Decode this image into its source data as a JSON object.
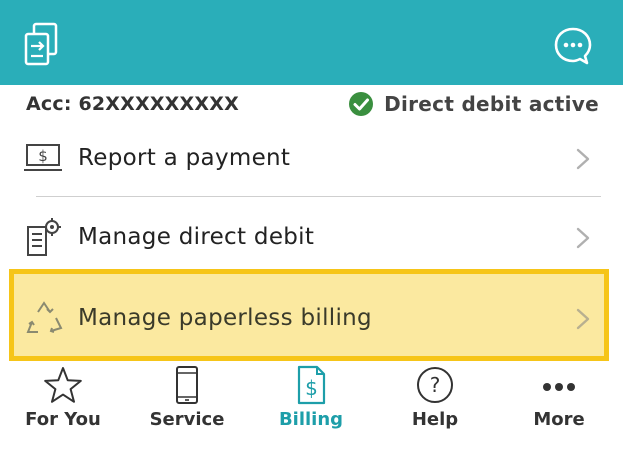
{
  "account": {
    "label": "Acc: 62XXXXXXXXX",
    "status": "Direct debit active",
    "status_color": "#3a8f3f"
  },
  "menu": {
    "items": [
      {
        "label": "Report a payment",
        "icon": "cash-screen-icon"
      },
      {
        "label": "Manage direct debit",
        "icon": "document-gear-icon"
      },
      {
        "label": "Manage paperless billing",
        "icon": "recycle-icon",
        "highlighted": true
      }
    ]
  },
  "tabs": [
    {
      "label": "For You",
      "icon": "star-icon"
    },
    {
      "label": "Service",
      "icon": "phone-icon"
    },
    {
      "label": "Billing",
      "icon": "bill-dollar-icon",
      "active": true
    },
    {
      "label": "Help",
      "icon": "question-icon"
    },
    {
      "label": "More",
      "icon": "more-dots-icon"
    }
  ],
  "colors": {
    "header": "#2aaeb9",
    "accent": "#1d9ea9",
    "highlight_border": "#f6c518",
    "highlight_fill": "#fbe9a0"
  }
}
